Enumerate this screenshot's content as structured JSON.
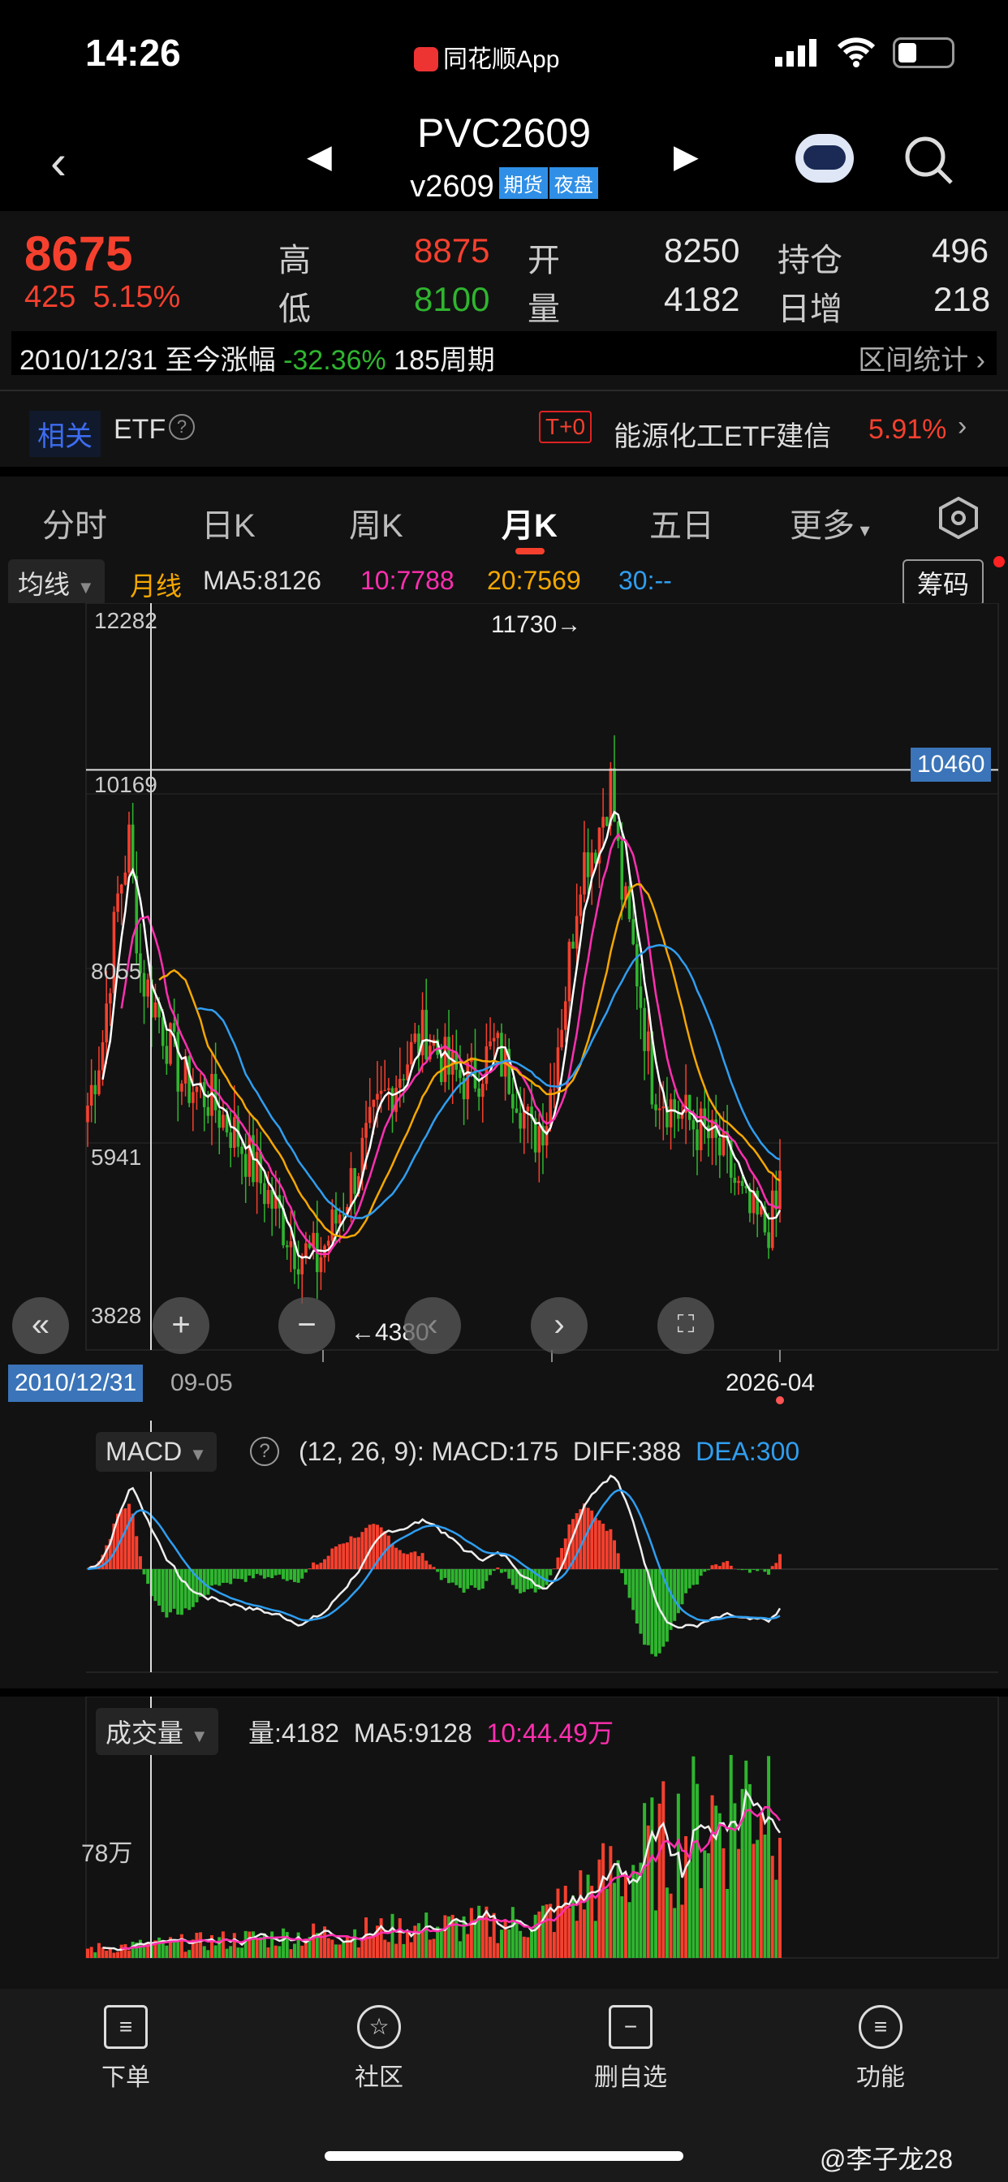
{
  "status": {
    "time": "14:26",
    "app": "同花顺App"
  },
  "header": {
    "symbol": "PVC2609",
    "contract": "v2609",
    "tags": [
      "期货",
      "夜盘"
    ]
  },
  "quote": {
    "price": "8675",
    "change": "425",
    "change_pct": "5.15%",
    "high_label": "高",
    "high": "8875",
    "low_label": "低",
    "low": "8100",
    "open_label": "开",
    "open": "8250",
    "vol_label": "量",
    "volume": "4182",
    "oi_label": "持仓",
    "oi": "496",
    "daily_inc_label": "日增",
    "daily_inc": "218"
  },
  "interval": {
    "date": "2010/12/31",
    "text": "至今涨幅",
    "pct": "-32.36%",
    "periods": "185周期",
    "stats": "区间统计"
  },
  "etf": {
    "tag": "相关",
    "label": "ETF",
    "t0": "T+0",
    "name": "能源化工ETF建信",
    "pct": "5.91%"
  },
  "tabs": [
    "分时",
    "日K",
    "周K",
    "月K",
    "五日",
    "更多"
  ],
  "active_tab": 3,
  "ma": {
    "selector": "均线",
    "period": "月线",
    "ma5": "MA5:8126",
    "ma10": "10:7788",
    "ma20": "20:7569",
    "ma30": "30:--",
    "chips": "筹码"
  },
  "chart": {
    "y_labels": [
      "12282",
      "10169",
      "8055",
      "5941",
      "3828"
    ],
    "y_values": [
      12282,
      10169,
      8055,
      5941,
      3828
    ],
    "max_label": "11730→",
    "min_label": "←4380",
    "cursor_price": "10460",
    "x_labels": [
      "2010/12/31",
      "09-05",
      "2026-04"
    ],
    "controls": [
      "«",
      "+",
      "−",
      "‹",
      "›",
      "⛶"
    ],
    "price_path": [
      [
        0,
        6400
      ],
      [
        4,
        7200
      ],
      [
        8,
        8900
      ],
      [
        11,
        9600
      ],
      [
        14,
        8000
      ],
      [
        18,
        7600
      ],
      [
        25,
        6700
      ],
      [
        32,
        6500
      ],
      [
        40,
        6000
      ],
      [
        48,
        5300
      ],
      [
        55,
        4700
      ],
      [
        61,
        4500
      ],
      [
        66,
        5000
      ],
      [
        72,
        5700
      ],
      [
        78,
        6400
      ],
      [
        84,
        6900
      ],
      [
        90,
        7300
      ],
      [
        96,
        6800
      ],
      [
        102,
        6700
      ],
      [
        108,
        7100
      ],
      [
        114,
        6600
      ],
      [
        118,
        6000
      ],
      [
        122,
        6300
      ],
      [
        127,
        7800
      ],
      [
        131,
        9300
      ],
      [
        135,
        9600
      ],
      [
        139,
        10300
      ],
      [
        142,
        9000
      ],
      [
        146,
        8000
      ],
      [
        150,
        6700
      ],
      [
        155,
        6400
      ],
      [
        160,
        6200
      ],
      [
        165,
        6000
      ],
      [
        170,
        5700
      ],
      [
        175,
        5100
      ],
      [
        180,
        4900
      ],
      [
        183,
        5100
      ],
      [
        184,
        5500
      ]
    ]
  },
  "macd": {
    "selector": "MACD",
    "params": "(12, 26, 9):",
    "macd": "MACD:175",
    "diff": "DIFF:388",
    "dea": "DEA:300"
  },
  "volume": {
    "selector": "成交量",
    "vol": "量:4182",
    "ma5": "MA5:9128",
    "ma10": "10:44.49万",
    "y_label": "78万"
  },
  "toolbar": [
    "下单",
    "社区",
    "删自选",
    "功能"
  ],
  "watermark": "@李子龙28",
  "colors": {
    "up": "#f5402e",
    "down": "#2fb52f",
    "ma5": "#ffffff",
    "ma10": "#ff2fb0",
    "ma20": "#f5a700",
    "ma30": "#2f9ef0"
  }
}
